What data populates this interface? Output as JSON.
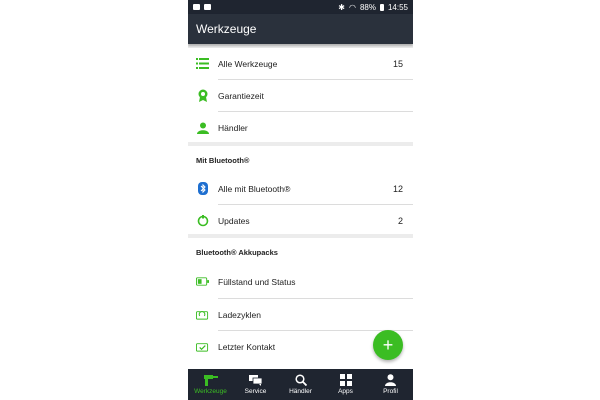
{
  "status": {
    "battery": "88%",
    "time": "14:55"
  },
  "appbar": {
    "title": "Werkzeuge"
  },
  "colors": {
    "accent": "#3bbd23",
    "dark": "#2a313c",
    "bluetooth": "#1e6fd0"
  },
  "section1": {
    "items": [
      {
        "label": "Alle Werkzeuge",
        "count": "15",
        "icon": "list-icon"
      },
      {
        "label": "Garantiezeit",
        "count": "",
        "icon": "warranty-badge-icon"
      },
      {
        "label": "Händler",
        "count": "",
        "icon": "dealer-person-icon"
      }
    ]
  },
  "section2": {
    "title": "Mit Bluetooth®",
    "items": [
      {
        "label": "Alle mit Bluetooth®",
        "count": "12",
        "icon": "bluetooth-icon"
      },
      {
        "label": "Updates",
        "count": "2",
        "icon": "update-icon"
      }
    ]
  },
  "section3": {
    "title": "Bluetooth® Akkupacks",
    "items": [
      {
        "label": "Füllstand und Status",
        "count": "",
        "icon": "battery-icon"
      },
      {
        "label": "Ladezyklen",
        "count": "",
        "icon": "charge-cycle-icon"
      },
      {
        "label": "Letzter Kontakt",
        "count": "",
        "icon": "last-contact-icon"
      }
    ]
  },
  "fab": {
    "label": "+"
  },
  "nav": {
    "items": [
      {
        "label": "Werkzeuge",
        "icon": "drill-icon"
      },
      {
        "label": "Service",
        "icon": "chat-icon"
      },
      {
        "label": "Händler",
        "icon": "search-icon"
      },
      {
        "label": "Apps",
        "icon": "apps-grid-icon"
      },
      {
        "label": "Profil",
        "icon": "profile-icon"
      }
    ]
  }
}
